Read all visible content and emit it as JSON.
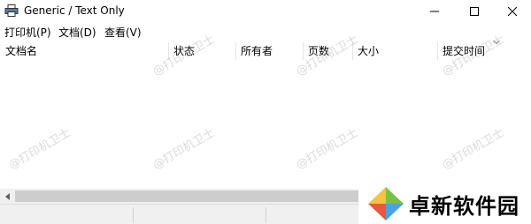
{
  "window": {
    "title": "Generic / Text Only"
  },
  "menu": {
    "printer": "打印机(P)",
    "document": "文档(D)",
    "view": "查看(V)"
  },
  "columns": [
    {
      "label": "文档名"
    },
    {
      "label": "状态"
    },
    {
      "label": "所有者"
    },
    {
      "label": "页数"
    },
    {
      "label": "大小"
    },
    {
      "label": "提交时间"
    }
  ],
  "watermark": "@打印机卫士",
  "brand": {
    "name": "卓新软件园"
  },
  "colors": {
    "titlebar": "#ffffff",
    "scrollbar_track": "#f0f0f0",
    "scrollbar_thumb": "#cdcdcd",
    "status_bar": "#f0f0f0"
  }
}
